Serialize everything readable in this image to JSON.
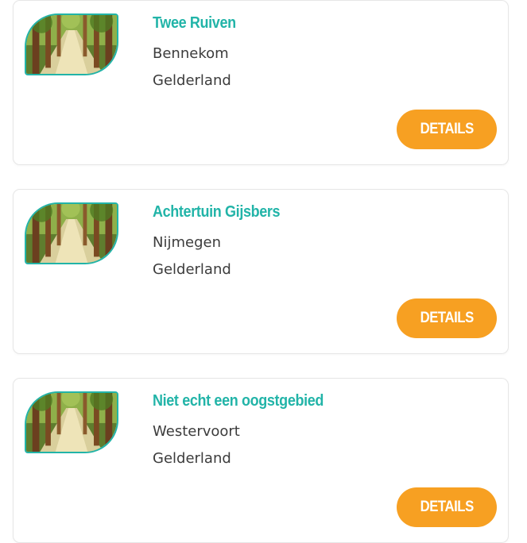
{
  "listings": [
    {
      "title": "Twee Ruiven",
      "city": "Bennekom",
      "region": "Gelderland",
      "button": "DETAILS"
    },
    {
      "title": "Achtertuin Gijsbers",
      "city": "Nijmegen",
      "region": "Gelderland",
      "button": "DETAILS"
    },
    {
      "title": "Niet echt een oogstgebied",
      "city": "Westervoort",
      "region": "Gelderland",
      "button": "DETAILS"
    }
  ],
  "colors": {
    "title": "#22b4a8",
    "button": "#f7a022",
    "text": "#3c3c3c",
    "card_border": "#e6e6e6"
  },
  "icons": {
    "thumbnail": "forest-path-photo"
  }
}
